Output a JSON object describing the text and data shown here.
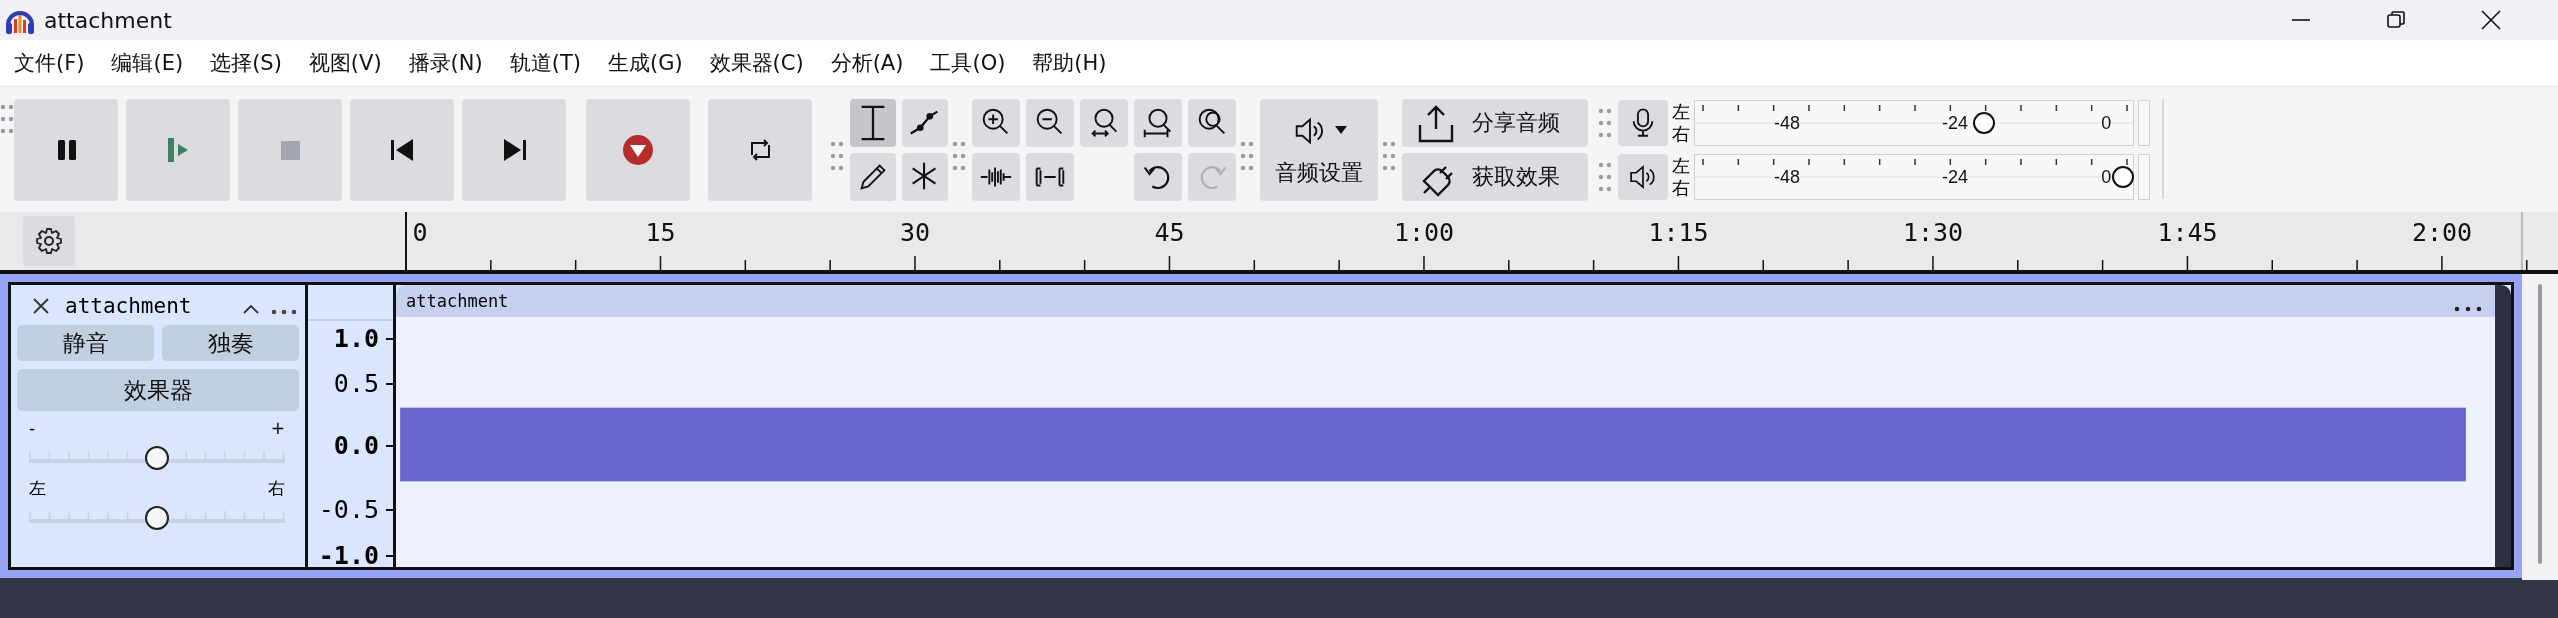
{
  "window": {
    "title": "attachment"
  },
  "menu": [
    {
      "label": "文件(F)"
    },
    {
      "label": "编辑(E)"
    },
    {
      "label": "选择(S)"
    },
    {
      "label": "视图(V)"
    },
    {
      "label": "播录(N)"
    },
    {
      "label": "轨道(T)"
    },
    {
      "label": "生成(G)"
    },
    {
      "label": "效果器(C)"
    },
    {
      "label": "分析(A)"
    },
    {
      "label": "工具(O)"
    },
    {
      "label": "帮助(H)"
    }
  ],
  "transport": [
    {
      "kind": "pause"
    },
    {
      "kind": "play"
    },
    {
      "kind": "stop"
    },
    {
      "kind": "skip-start"
    },
    {
      "kind": "skip-end"
    },
    {
      "kind": "record"
    },
    {
      "kind": "loop"
    }
  ],
  "tools": [
    {
      "kind": "select",
      "selected": true
    },
    {
      "kind": "envelope",
      "selected": false
    },
    {
      "kind": "draw",
      "selected": false
    },
    {
      "kind": "multi",
      "selected": false
    }
  ],
  "zoom_tools": [
    {
      "kind": "zoom-in",
      "disabled": false
    },
    {
      "kind": "zoom-out",
      "disabled": false
    },
    {
      "kind": "fit-selection",
      "disabled": false
    },
    {
      "kind": "fit-project",
      "disabled": false
    },
    {
      "kind": "zoom-toggle",
      "disabled": false
    }
  ],
  "edit_tools": [
    {
      "kind": "trim",
      "disabled": false
    },
    {
      "kind": "silence",
      "disabled": false
    },
    {
      "kind": "undo",
      "disabled": false
    },
    {
      "kind": "redo",
      "disabled": true
    }
  ],
  "audio_setup": {
    "label": "音频设置"
  },
  "share": [
    {
      "kind": "share",
      "label": "分享音频"
    },
    {
      "kind": "effects",
      "label": "获取效果"
    }
  ],
  "meters": [
    {
      "kind": "record",
      "left": "左",
      "right": "右",
      "ticks": [
        "-48",
        "-24",
        "0"
      ],
      "level": 0.67
    },
    {
      "kind": "playback",
      "left": "左",
      "right": "右",
      "ticks": [
        "-48",
        "-24",
        "0"
      ],
      "level": 1
    }
  ],
  "ruler": {
    "labels": [
      "0",
      "15",
      "30",
      "45",
      "1:00",
      "1:15",
      "1:30",
      "1:45",
      "2:00"
    ]
  },
  "track": {
    "name": "attachment",
    "mute": "静音",
    "solo": "独奏",
    "effects": "效果器",
    "gain": {
      "minus": "-",
      "plus": "+",
      "level": 0.5
    },
    "pan": {
      "left": "左",
      "right": "右",
      "level": 0.5
    },
    "scale": [
      "1.0",
      "0.5",
      "0.0",
      "-0.5",
      "-1.0"
    ],
    "clip": {
      "name": "attachment"
    }
  }
}
